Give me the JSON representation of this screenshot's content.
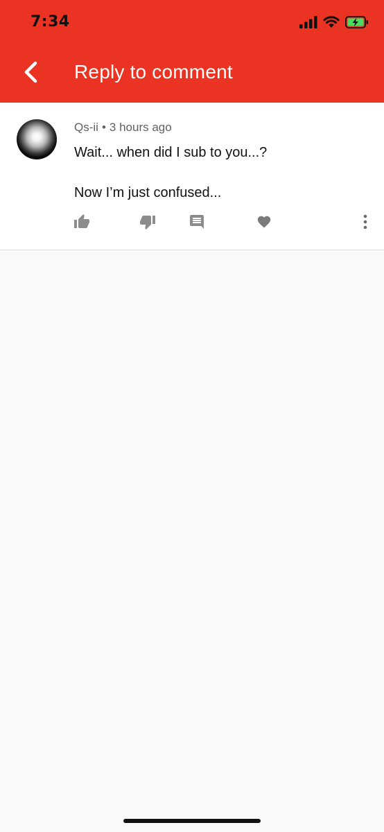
{
  "status_bar": {
    "time": "7:34",
    "icons": [
      "cellular-signal-icon",
      "wifi-icon",
      "battery-charging-icon"
    ]
  },
  "header": {
    "title": "Reply to comment",
    "back_icon": "chevron-left-icon",
    "background_color": "#ea3323"
  },
  "comment": {
    "author": "Qs-ii",
    "separator": "•",
    "timestamp": "3 hours ago",
    "lines": [
      "Wait... when did I sub to you...?",
      "Now I’m just confused..."
    ],
    "actions": [
      "thumbs-up-icon",
      "thumbs-down-icon",
      "reply-icon",
      "heart-icon",
      "more-vert-icon"
    ]
  }
}
